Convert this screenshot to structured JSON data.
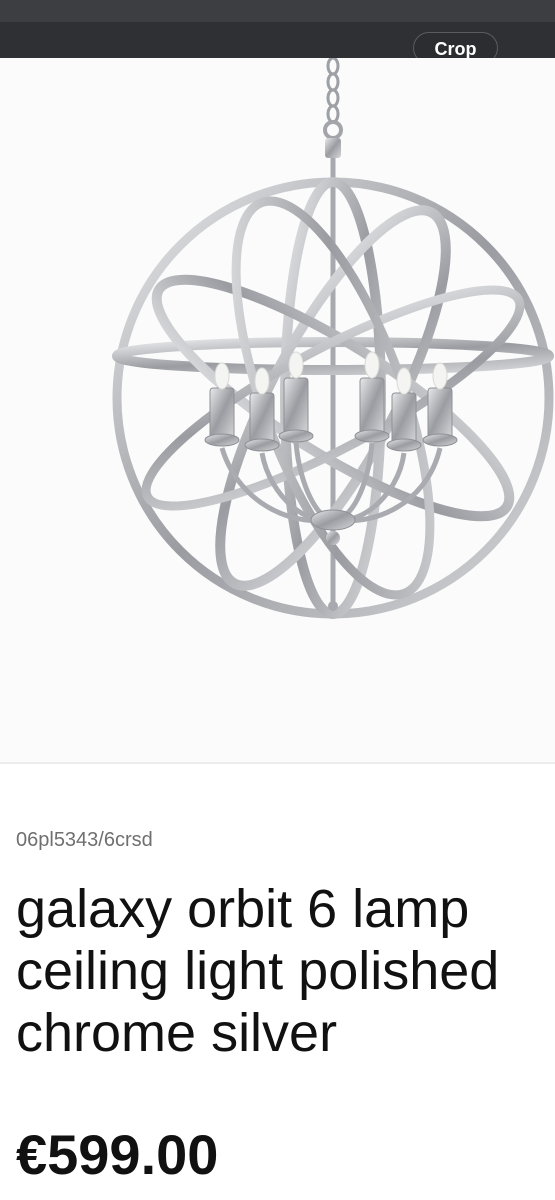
{
  "toolbar": {
    "crop_label": "Crop"
  },
  "product": {
    "sku": "06pl5343/6crsd",
    "title_lines": [
      "galaxy orbit 6 lamp",
      "ceiling light polished",
      "chrome silver"
    ],
    "price": "€599.00",
    "image_icon": "chandelier-image"
  },
  "colors": {
    "top_bar": "#2e3033",
    "chrome": "#c4c6ca",
    "text": "#111111",
    "sku_text": "#6f6f6f"
  }
}
